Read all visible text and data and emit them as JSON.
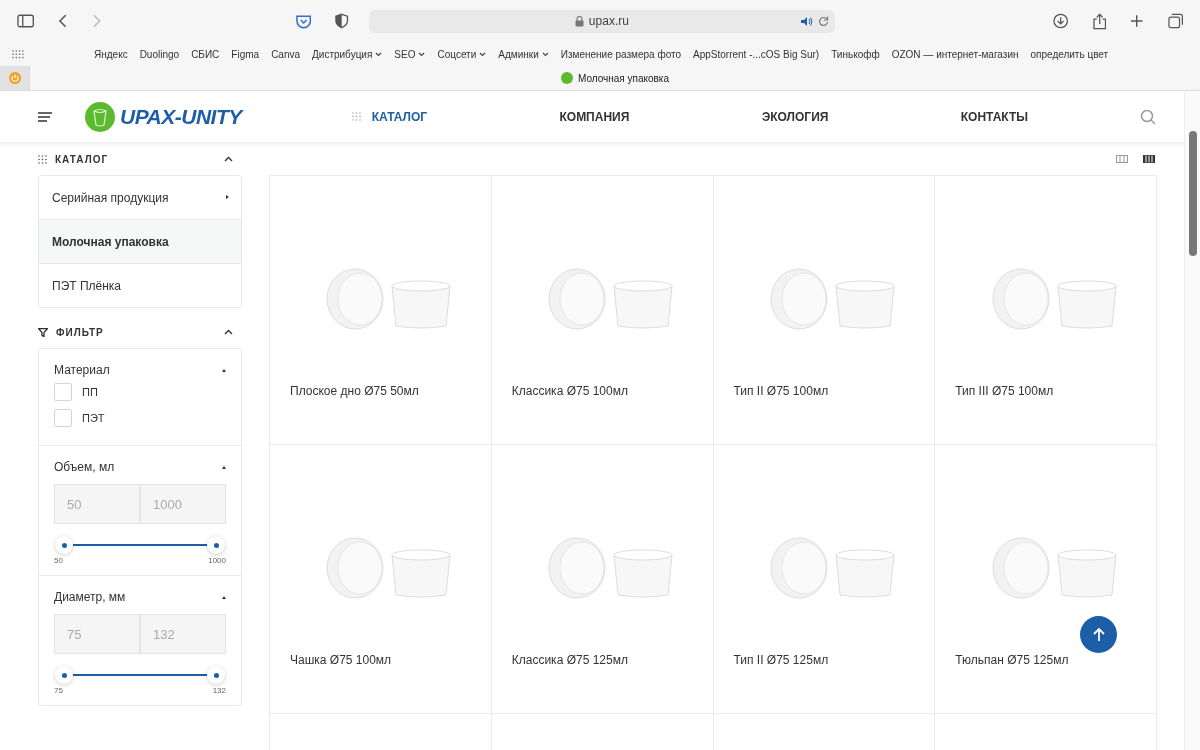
{
  "browser": {
    "address": "upax.ru",
    "bookmarks": [
      {
        "label": "Яндекс",
        "folder": false
      },
      {
        "label": "Duolingo",
        "folder": false
      },
      {
        "label": "СБИС",
        "folder": false
      },
      {
        "label": "Figma",
        "folder": false
      },
      {
        "label": "Canva",
        "folder": false
      },
      {
        "label": "Дистрибуция",
        "folder": true
      },
      {
        "label": "SEO",
        "folder": true
      },
      {
        "label": "Соцсети",
        "folder": true
      },
      {
        "label": "Админки",
        "folder": true
      },
      {
        "label": "Изменение размера фото",
        "folder": false
      },
      {
        "label": "AppStorrent -...cOS Big Sur)",
        "folder": false
      },
      {
        "label": "Тинькофф",
        "folder": false
      },
      {
        "label": "OZON — интернет-магазин",
        "folder": false
      },
      {
        "label": "определить цвет",
        "folder": false
      }
    ],
    "tab_title": "Молочная упаковка"
  },
  "site": {
    "logo": "UPAX-UNITY",
    "nav": [
      {
        "label": "КАТАЛОГ",
        "selected": true
      },
      {
        "label": "КОМПАНИЯ",
        "selected": false
      },
      {
        "label": "ЭКОЛОГИЯ",
        "selected": false
      },
      {
        "label": "КОНТАКТЫ",
        "selected": false
      }
    ]
  },
  "sidebar": {
    "catalog_title": "КАТАЛОГ",
    "catalog_items": [
      {
        "label": "Серийная продукция",
        "selected": false,
        "has_submenu": true
      },
      {
        "label": "Молочная упаковка",
        "selected": true,
        "has_submenu": false
      },
      {
        "label": "ПЭТ Плёнка",
        "selected": false,
        "has_submenu": false
      }
    ],
    "filter_title": "ФИЛЬТР",
    "filters": [
      {
        "kind": "checkboxes",
        "title": "Материал",
        "options": [
          {
            "label": "ПП",
            "checked": false
          },
          {
            "label": "ПЭТ",
            "checked": false
          }
        ]
      },
      {
        "kind": "range",
        "title": "Объем, мл",
        "from_placeholder": "50",
        "to_placeholder": "1000",
        "thumbs": [
          {
            "level": 0
          },
          {
            "level": 1
          }
        ],
        "min_label": "50",
        "max_label": "1000"
      },
      {
        "kind": "range",
        "title": "Диаметр, мм",
        "from_placeholder": "75",
        "to_placeholder": "132",
        "thumbs": [
          {
            "level": 0
          },
          {
            "level": 1
          }
        ],
        "min_label": "75",
        "max_label": "132"
      }
    ]
  },
  "view_modes": [
    {
      "selected": false
    },
    {
      "selected": true
    }
  ],
  "products": [
    {
      "name": "Плоское дно Ø75 50мл"
    },
    {
      "name": "Классика Ø75 100мл"
    },
    {
      "name": "Тип II Ø75 100мл"
    },
    {
      "name": "Тип III Ø75 100мл"
    },
    {
      "name": "Чашка Ø75 100мл"
    },
    {
      "name": "Классика Ø75 125мл"
    },
    {
      "name": "Тип II Ø75 125мл"
    },
    {
      "name": "Тюльпан Ø75 125мл"
    }
  ]
}
